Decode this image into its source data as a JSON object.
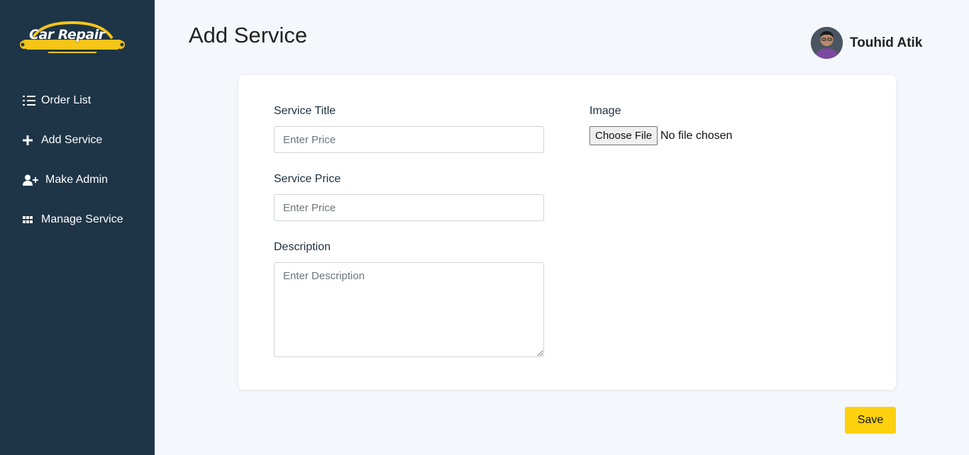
{
  "brand": {
    "name": "Car Repair",
    "tagline": "SERVICES"
  },
  "sidebar": {
    "items": [
      {
        "label": "Order List",
        "icon": "list-ordered-icon"
      },
      {
        "label": "Add Service",
        "icon": "plus-icon"
      },
      {
        "label": "Make Admin",
        "icon": "user-plus-icon"
      },
      {
        "label": "Manage Service",
        "icon": "grid-icon"
      }
    ]
  },
  "header": {
    "title": "Add Service",
    "user_name": "Touhid Atik"
  },
  "form": {
    "service_title": {
      "label": "Service Title",
      "placeholder": "Enter Price",
      "value": ""
    },
    "service_price": {
      "label": "Service Price",
      "placeholder": "Enter Price",
      "value": ""
    },
    "description": {
      "label": "Description",
      "placeholder": "Enter Description",
      "value": ""
    },
    "image": {
      "label": "Image",
      "button_label": "Choose File",
      "status": "No file chosen"
    },
    "save_label": "Save"
  },
  "colors": {
    "sidebar_bg": "#1e3547",
    "page_bg": "#f4f7fc",
    "accent": "#fdd10e",
    "logo_gold": "#f5c518"
  }
}
